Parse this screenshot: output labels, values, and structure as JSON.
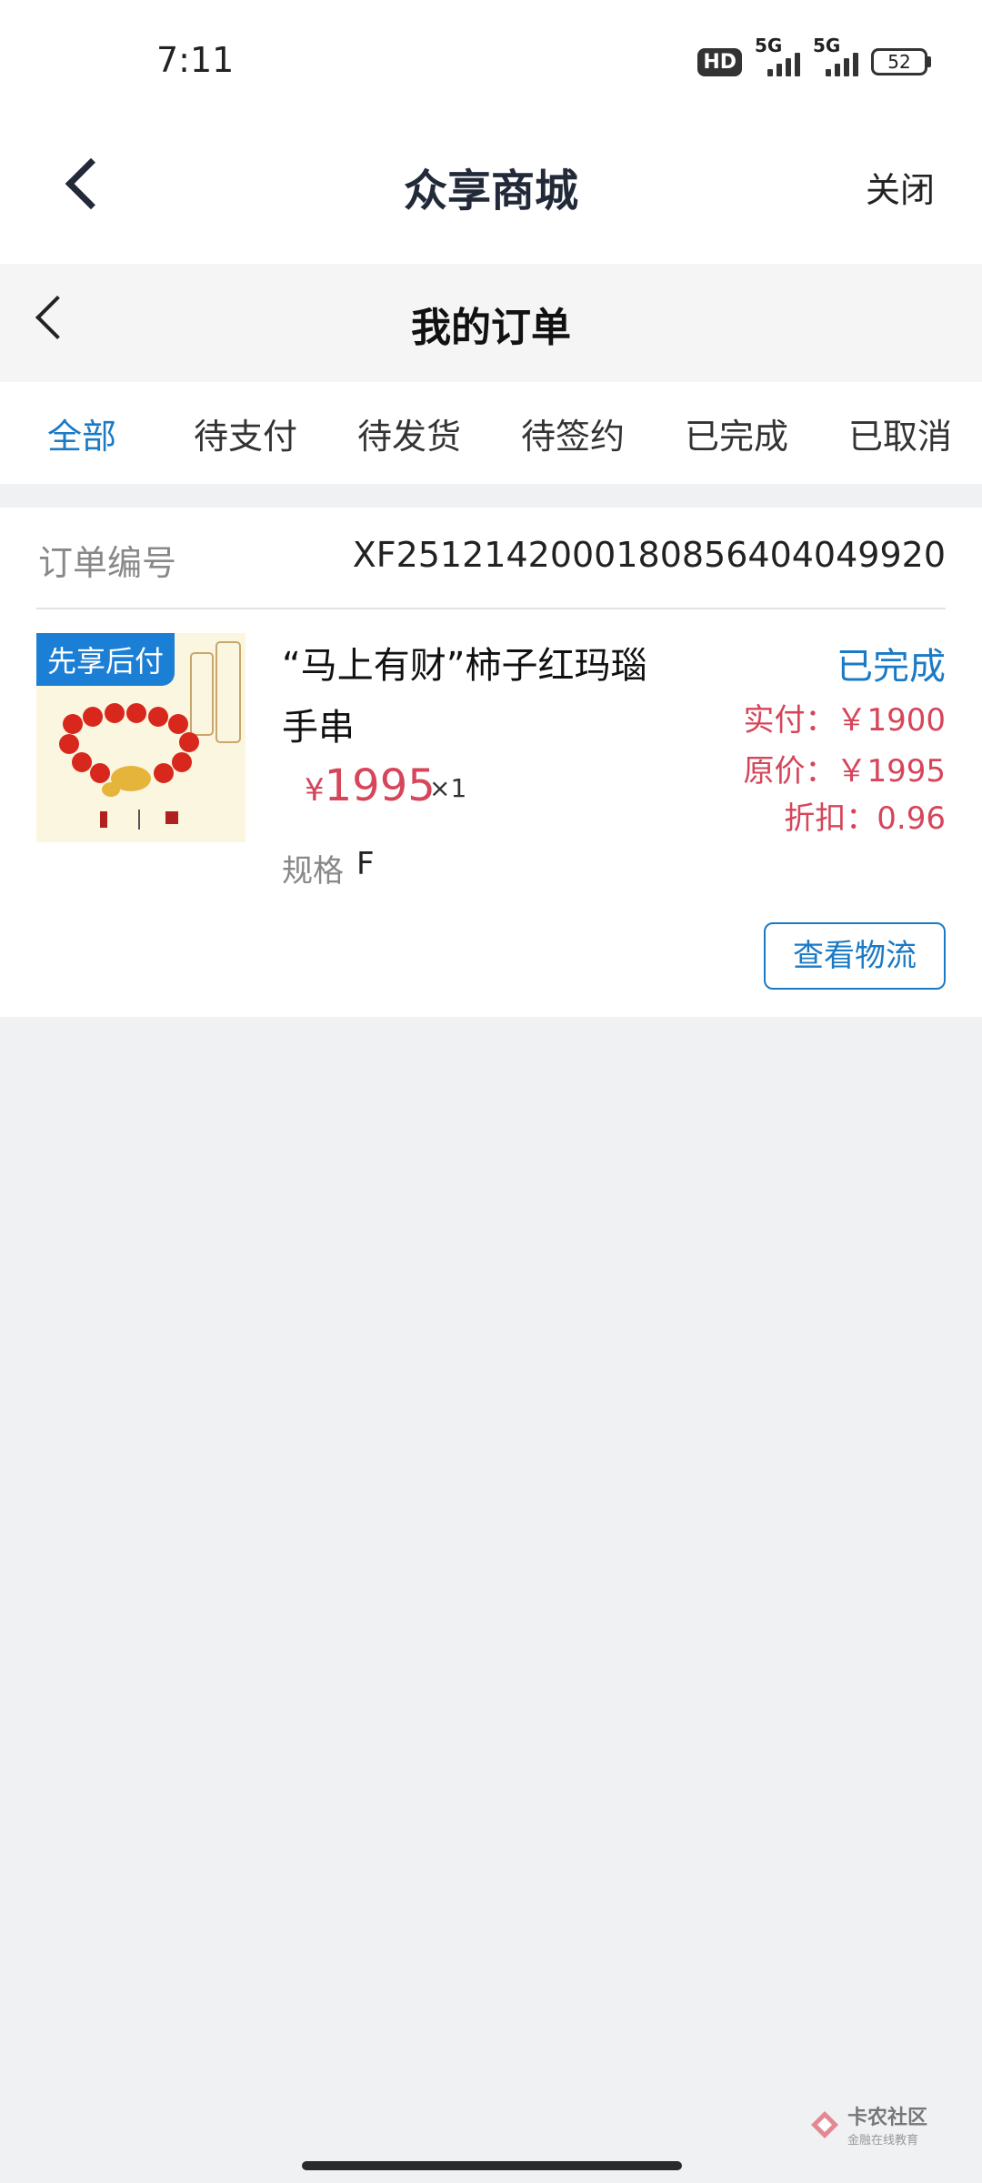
{
  "status_bar": {
    "time": "7:11",
    "hd_label": "HD",
    "net1_label": "5G",
    "net2_label": "5G",
    "battery": "52"
  },
  "titlebar": {
    "title": "众享商城",
    "close_label": "关闭"
  },
  "subheader": {
    "title": "我的订单"
  },
  "tabs": [
    {
      "label": "全部",
      "active": true
    },
    {
      "label": "待支付",
      "active": false
    },
    {
      "label": "待发货",
      "active": false
    },
    {
      "label": "待签约",
      "active": false
    },
    {
      "label": "已完成",
      "active": false
    },
    {
      "label": "已取消",
      "active": false
    }
  ],
  "order": {
    "order_no_label": "订单编号",
    "order_no": "XF2512142000180856404049920",
    "thumb_badge": "先享后付",
    "product_name": "“马上有财”柿子红玛瑙手串",
    "price_currency": "¥",
    "price": "1995",
    "quantity": "×1",
    "spec_label": "规格",
    "spec_value": "F",
    "status": "已完成",
    "paid": "实付：￥1900",
    "original": "原价：￥1995",
    "discount": "折扣：0.96",
    "logistics_button": "查看物流"
  },
  "watermark": {
    "line1": "卡农社区",
    "line2": "金融在线教育"
  },
  "colors": {
    "accent": "#1b7ac5",
    "price": "#d6455a",
    "badge": "#1c7fd6",
    "background": "#f0f1f3"
  }
}
